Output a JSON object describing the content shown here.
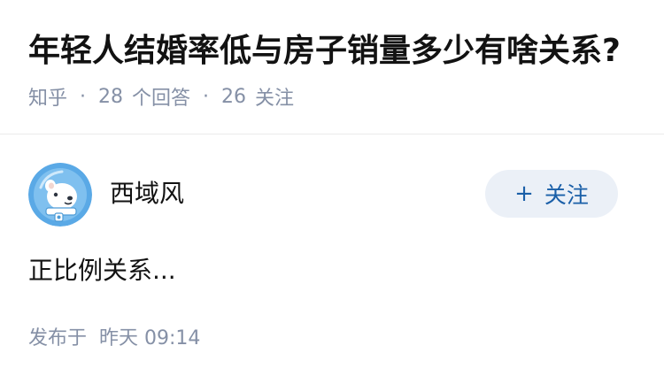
{
  "question": {
    "title": "年轻人结婚率低与房子销量多少有啥关系?",
    "source": "知乎",
    "separator": "·",
    "answer_count": "28",
    "answer_label": "个回答",
    "follower_count": "26",
    "follower_label": "关注"
  },
  "answer": {
    "author": {
      "name": "西域风",
      "avatar_icon": "cartoon-bear-astronaut-avatar",
      "follow_icon": "plus-icon",
      "follow_icon_glyph": "+",
      "follow_label": "关注"
    },
    "content": "正比例关系...",
    "published_prefix": "发布于",
    "published_time": "昨天 09:14"
  },
  "colors": {
    "title": "#121212",
    "meta": "#8590a6",
    "follow_text": "#1a5fa8",
    "follow_bg": "#ebf0f7",
    "avatar_bg": "#5aa9e6",
    "divider": "#ebebeb"
  }
}
